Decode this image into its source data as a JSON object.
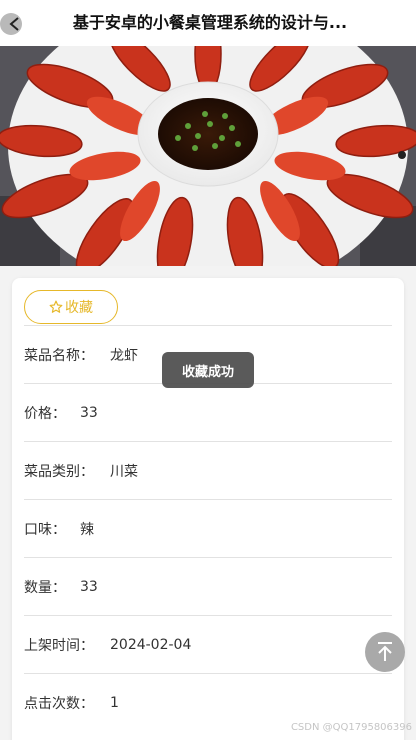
{
  "header": {
    "title": "基于安卓的小餐桌管理系统的设计与..."
  },
  "favorite": {
    "label": "收藏"
  },
  "fields": [
    {
      "label": "菜品名称：",
      "value": "龙虾"
    },
    {
      "label": "价格：",
      "value": "33"
    },
    {
      "label": "菜品类别：",
      "value": "川菜"
    },
    {
      "label": "口味：",
      "value": "辣"
    },
    {
      "label": "数量：",
      "value": "33"
    },
    {
      "label": "上架时间：",
      "value": "2024-02-04"
    },
    {
      "label": "点击次数：",
      "value": "1"
    }
  ],
  "toast": {
    "text": "收藏成功"
  },
  "watermark": "CSDN @QQ1795806396",
  "colors": {
    "accent": "#e6b82a",
    "toast_bg": "#4c4c4c",
    "scroll_top_bg": "#a9a9a9"
  },
  "icons": {
    "back": "chevron-left-icon",
    "favorite": "star-outline-icon",
    "scroll_top": "arrow-up-to-line-icon"
  }
}
